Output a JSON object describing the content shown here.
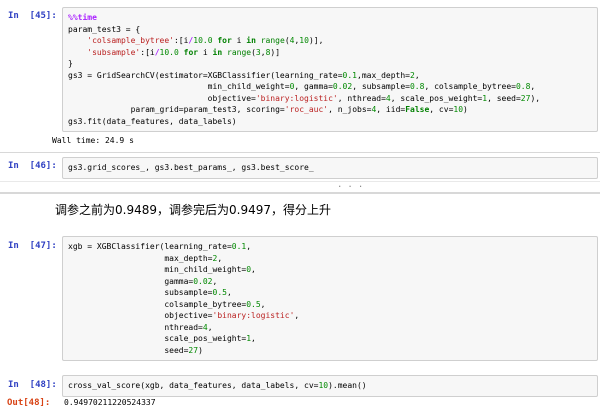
{
  "colors": {
    "page_bg": "#FFFFFF",
    "cell_bg": "#F7F7F7",
    "cell_border": "#CFCFCF",
    "in_prompt": "#2E3FC2",
    "out_prompt": "#D84315",
    "keyword": "#008000",
    "builtin": "#008000",
    "number": "#008800",
    "string": "#BA2121",
    "operator": "#AA22FF",
    "magic": "#AA22FF"
  },
  "cells": {
    "c45": {
      "prompt": "In  [45]:",
      "code": [
        [
          [
            "m",
            "%%time"
          ]
        ],
        [
          [
            "p",
            "param_test3 = {"
          ]
        ],
        [
          [
            "p",
            "    "
          ],
          [
            "s",
            "'colsample_bytree'"
          ],
          [
            "p",
            ":[i"
          ],
          [
            "o",
            "/"
          ],
          [
            "n",
            "10.0"
          ],
          [
            "p",
            " "
          ],
          [
            "k",
            "for"
          ],
          [
            "p",
            " i "
          ],
          [
            "k",
            "in"
          ],
          [
            "p",
            " "
          ],
          [
            "b",
            "range"
          ],
          [
            "p",
            "("
          ],
          [
            "n",
            "4"
          ],
          [
            "p",
            ","
          ],
          [
            "n",
            "10"
          ],
          [
            "p",
            ")],"
          ]
        ],
        [
          [
            "p",
            "    "
          ],
          [
            "s",
            "'subsample'"
          ],
          [
            "p",
            ":[i"
          ],
          [
            "o",
            "/"
          ],
          [
            "n",
            "10.0"
          ],
          [
            "p",
            " "
          ],
          [
            "k",
            "for"
          ],
          [
            "p",
            " i "
          ],
          [
            "k",
            "in"
          ],
          [
            "p",
            " "
          ],
          [
            "b",
            "range"
          ],
          [
            "p",
            "("
          ],
          [
            "n",
            "3"
          ],
          [
            "p",
            ","
          ],
          [
            "n",
            "8"
          ],
          [
            "p",
            ")]"
          ]
        ],
        [
          [
            "p",
            "}"
          ]
        ],
        [
          [
            "p",
            "gs3 = GridSearchCV(estimator=XGBClassifier(learning_rate="
          ],
          [
            "n",
            "0.1"
          ],
          [
            "p",
            ",max_depth="
          ],
          [
            "n",
            "2"
          ],
          [
            "p",
            ","
          ]
        ],
        [
          [
            "p",
            "                             min_child_weight="
          ],
          [
            "n",
            "0"
          ],
          [
            "p",
            ", gamma="
          ],
          [
            "n",
            "0.02"
          ],
          [
            "p",
            ", subsample="
          ],
          [
            "n",
            "0.8"
          ],
          [
            "p",
            ", colsample_bytree="
          ],
          [
            "n",
            "0.8"
          ],
          [
            "p",
            ","
          ]
        ],
        [
          [
            "p",
            "                             objective="
          ],
          [
            "s",
            "'binary:logistic'"
          ],
          [
            "p",
            ", nthread="
          ],
          [
            "n",
            "4"
          ],
          [
            "p",
            ", scale_pos_weight="
          ],
          [
            "n",
            "1"
          ],
          [
            "p",
            ", seed="
          ],
          [
            "n",
            "27"
          ],
          [
            "p",
            "),"
          ]
        ],
        [
          [
            "p",
            "             param_grid=param_test3, scoring="
          ],
          [
            "s",
            "'roc_auc'"
          ],
          [
            "p",
            ", n_jobs="
          ],
          [
            "n",
            "4"
          ],
          [
            "p",
            ", iid="
          ],
          [
            "k",
            "False"
          ],
          [
            "p",
            ", cv="
          ],
          [
            "n",
            "10"
          ],
          [
            "p",
            ")"
          ]
        ],
        [
          [
            "p",
            "gs3.fit(data_features, data_labels)"
          ]
        ]
      ],
      "stream_output": "Wall time: 24.9 s"
    },
    "c46": {
      "prompt": "In  [46]:",
      "code": [
        [
          [
            "p",
            "gs3.grid_scores_, gs3.best_params_, gs3.best_score_"
          ]
        ]
      ],
      "collapsed_indicator": "..."
    },
    "md": {
      "text": "调参之前为0.9489，调参完后为0.9497，得分上升"
    },
    "c47": {
      "prompt": "In  [47]:",
      "code": [
        [
          [
            "p",
            "xgb = XGBClassifier(learning_rate="
          ],
          [
            "n",
            "0.1"
          ],
          [
            "p",
            ","
          ]
        ],
        [
          [
            "p",
            "                    max_depth="
          ],
          [
            "n",
            "2"
          ],
          [
            "p",
            ","
          ]
        ],
        [
          [
            "p",
            "                    min_child_weight="
          ],
          [
            "n",
            "0"
          ],
          [
            "p",
            ","
          ]
        ],
        [
          [
            "p",
            "                    gamma="
          ],
          [
            "n",
            "0.02"
          ],
          [
            "p",
            ","
          ]
        ],
        [
          [
            "p",
            "                    subsample="
          ],
          [
            "n",
            "0.5"
          ],
          [
            "p",
            ","
          ]
        ],
        [
          [
            "p",
            "                    colsample_bytree="
          ],
          [
            "n",
            "0.5"
          ],
          [
            "p",
            ","
          ]
        ],
        [
          [
            "p",
            "                    objective="
          ],
          [
            "s",
            "'binary:logistic'"
          ],
          [
            "p",
            ","
          ]
        ],
        [
          [
            "p",
            "                    nthread="
          ],
          [
            "n",
            "4"
          ],
          [
            "p",
            ","
          ]
        ],
        [
          [
            "p",
            "                    scale_pos_weight="
          ],
          [
            "n",
            "1"
          ],
          [
            "p",
            ","
          ]
        ],
        [
          [
            "p",
            "                    seed="
          ],
          [
            "n",
            "27"
          ],
          [
            "p",
            ")"
          ]
        ]
      ]
    },
    "c48": {
      "prompt": "In  [48]:",
      "code": [
        [
          [
            "p",
            "cross_val_score(xgb, data_features, data_labels, cv="
          ],
          [
            "n",
            "10"
          ],
          [
            "p",
            ").mean()"
          ]
        ]
      ],
      "out_prompt": "Out[48]:",
      "out_value": "0.94970211220524337"
    }
  }
}
